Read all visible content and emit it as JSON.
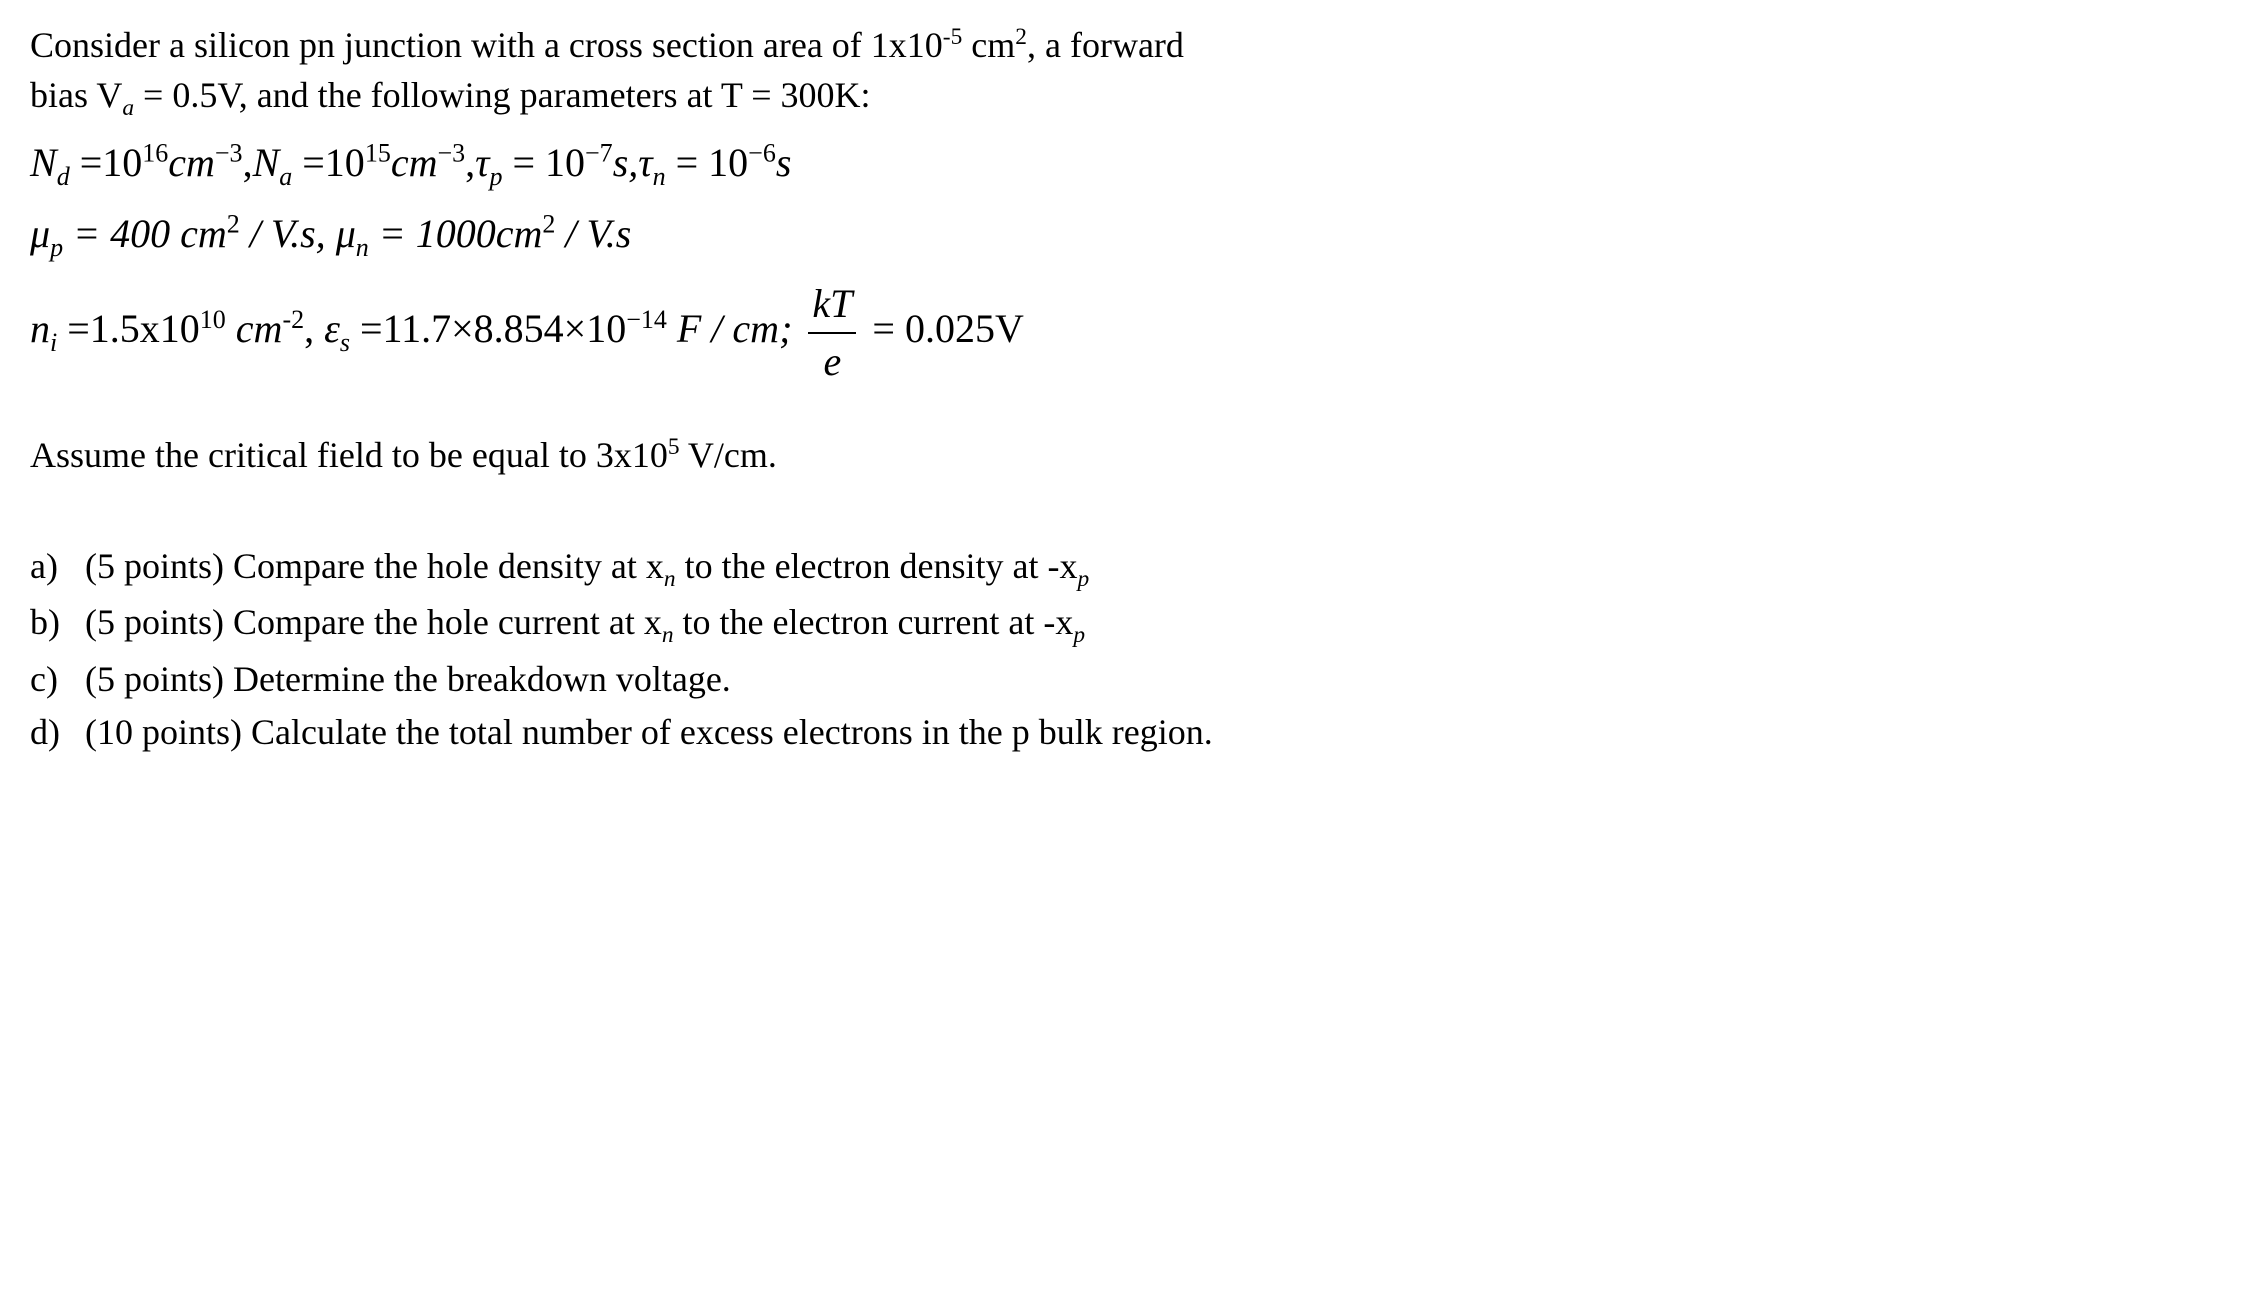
{
  "intro": {
    "line1_pre": "Consider a silicon pn junction with a cross section area of 1x10",
    "line1_sup1": "-5",
    "line1_mid": " cm",
    "line1_sup2": "2",
    "line1_post": ", a forward",
    "line2_pre": "bias V",
    "line2_sub": "a",
    "line2_post": " = 0.5V, and the following parameters at T = 300K:"
  },
  "param_line1": {
    "N": "N",
    "d": "d",
    "eq": " =10",
    "e16": "16",
    "cm": "cm",
    "m3": "−3",
    "com": ",",
    "a": "a",
    "e15": "15",
    "tau": "τ",
    "p": "p",
    "eq2": " = 10",
    "m7": "−7",
    "s": "s,",
    "n": "n",
    "m6": "−6",
    "s2": "s"
  },
  "param_line2": {
    "mu": "μ",
    "p": "p",
    "eq": " = 400 cm",
    "sq": "2",
    "vs": " / V.s, ",
    "n": "n",
    "eq2": " = 1000cm",
    "vs2": " / V.s"
  },
  "param_line3": {
    "n": "n",
    "i": "i",
    "eq": " =1.5x10",
    "e10": "10",
    "cm": " cm",
    "m2": "-2",
    "com": ", ",
    "eps": "ε",
    "s": "s",
    "eq2": " =11.7×8.854×10",
    "m14": "−14",
    "fcm": " F / cm; ",
    "kT": "kT",
    "e": "e",
    "eq3": " = 0.025V"
  },
  "assume": {
    "pre": "Assume the critical field to be equal to 3x10",
    "sup": "5",
    "post": "  V/cm."
  },
  "questions": {
    "a": {
      "label": "a)",
      "pre": "  (5 points) Compare the hole density at x",
      "sub1": "n",
      "mid": " to the electron density at -x",
      "sub2": "p"
    },
    "b": {
      "label": "b)",
      "pre": " (5 points) Compare the hole current at x",
      "sub1": "n",
      "mid": " to the electron current at -x",
      "sub2": "p"
    },
    "c": {
      "label": "c)",
      "text": " (5 points) Determine the breakdown voltage."
    },
    "d": {
      "label": "d)",
      "text": " (10 points) Calculate the total number of excess electrons in the p bulk region."
    }
  }
}
